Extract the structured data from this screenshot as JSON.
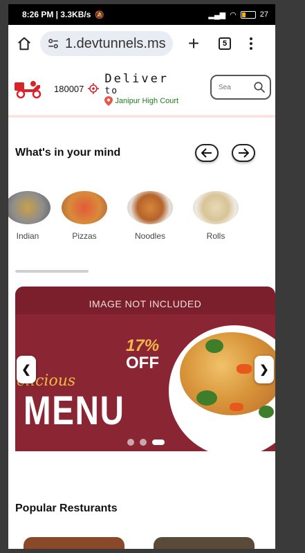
{
  "status_bar": {
    "time_speed": "8:26 PM | 3.3KB/s",
    "battery": "27",
    "battery_level": 0.27
  },
  "browser": {
    "url": "1.devtunnels.ms",
    "tab_count": "5"
  },
  "header": {
    "pincode": "180007",
    "deliver_line1": "Deliver",
    "deliver_line2": "to",
    "location": "Janipur High Court",
    "search_placeholder": "Sea"
  },
  "categories_section": {
    "title": "What's in your mind",
    "items": [
      {
        "label": "Indian",
        "icon": "indian-thali-image"
      },
      {
        "label": "Pizzas",
        "icon": "pizza-image"
      },
      {
        "label": "Noodles",
        "icon": "noodles-image"
      },
      {
        "label": "Rolls",
        "icon": "rolls-image"
      }
    ]
  },
  "banner": {
    "watermark": "IMAGE NOT INCLUDED",
    "script_text": "elicious",
    "headline": "MENU",
    "discount_pct": "17%",
    "discount_off": "OFF",
    "prev_label": "❮",
    "next_label": "❯",
    "slides": 3,
    "active_slide": 3
  },
  "popular_section": {
    "title": "Popular Resturants"
  },
  "colors": {
    "banner_bg": "#8a2633",
    "accent_gold": "#f2b94a",
    "location_green": "#1f7a1f",
    "header_border": "#fde2e2"
  }
}
